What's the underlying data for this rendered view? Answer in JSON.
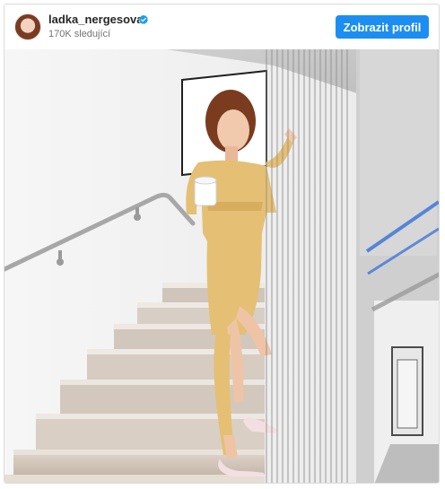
{
  "post": {
    "username": "ladka_nergesova",
    "followers": "170K sledující",
    "follow_label": "Zobrazit profil"
  },
  "icons": {
    "verified": "verified-badge-icon",
    "avatar": "profile-avatar"
  },
  "colors": {
    "primary_button": "#1d8ef1",
    "dress": "#e5bf74"
  }
}
